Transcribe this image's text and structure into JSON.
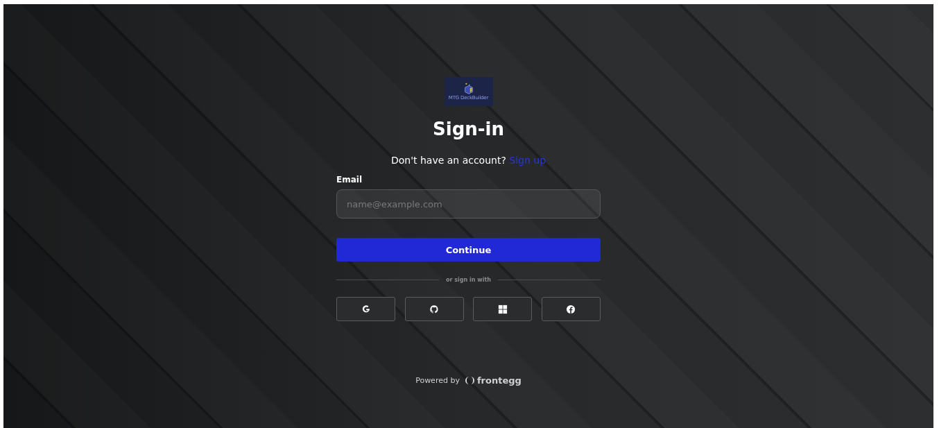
{
  "logo": {
    "text": "MTG DeckBuilder"
  },
  "title": "Sign-in",
  "signup_prompt": {
    "text": "Don't have an account?",
    "link": "Sign up"
  },
  "email": {
    "label": "Email",
    "placeholder": "name@example.com"
  },
  "continue_button": "Continue",
  "divider": "or sign in with",
  "social_buttons": [
    {
      "kind": "google"
    },
    {
      "kind": "github"
    },
    {
      "kind": "microsoft"
    },
    {
      "kind": "facebook"
    }
  ],
  "footer": {
    "text": "Powered by",
    "brand": "frontegg"
  }
}
